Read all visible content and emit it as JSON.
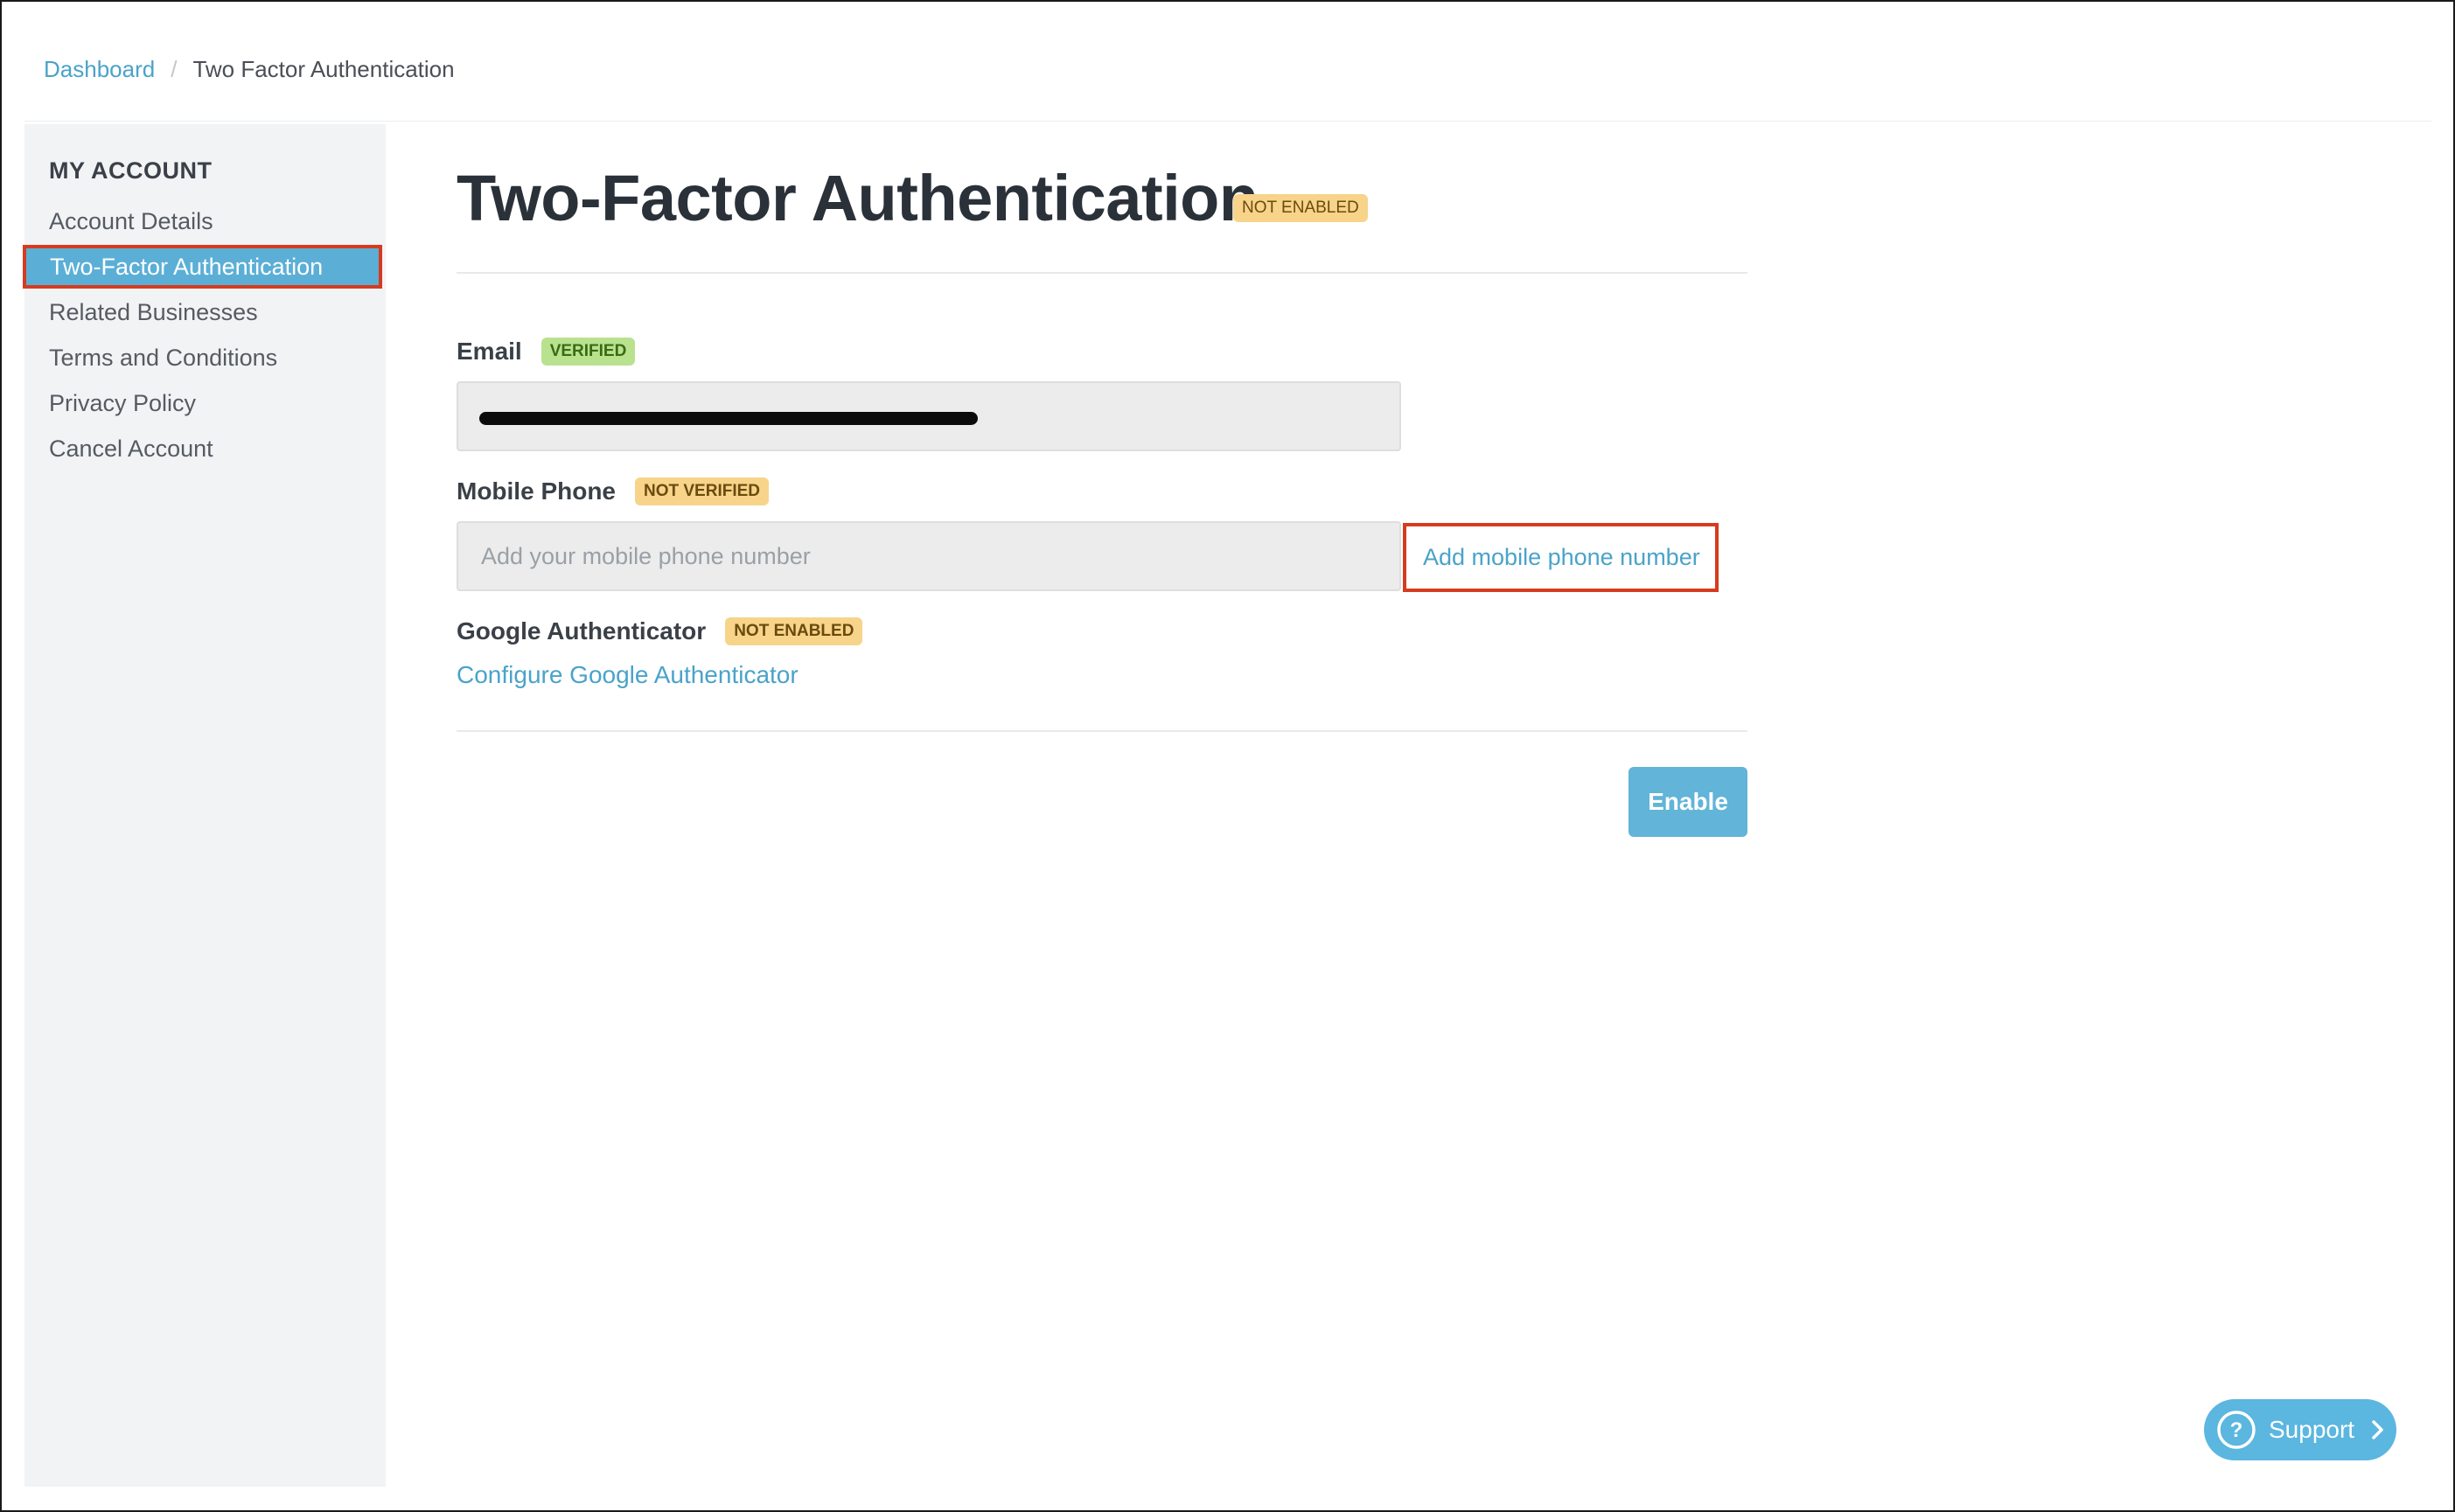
{
  "breadcrumb": {
    "home": "Dashboard",
    "separator": "/",
    "current": "Two Factor Authentication"
  },
  "sidebar": {
    "heading": "MY ACCOUNT",
    "items": [
      {
        "label": "Account Details"
      },
      {
        "label": "Two-Factor Authentication",
        "active": true
      },
      {
        "label": "Related Businesses"
      },
      {
        "label": "Terms and Conditions"
      },
      {
        "label": "Privacy Policy"
      },
      {
        "label": "Cancel Account"
      }
    ]
  },
  "main": {
    "title": "Two-Factor Authentication",
    "status_badge": "NOT ENABLED",
    "email": {
      "label": "Email",
      "badge": "VERIFIED",
      "value_redacted": true
    },
    "mobile": {
      "label": "Mobile Phone",
      "badge": "NOT VERIFIED",
      "placeholder": "Add your mobile phone number",
      "value": "",
      "add_link": "Add mobile phone number"
    },
    "google_auth": {
      "label": "Google Authenticator",
      "badge": "NOT ENABLED",
      "configure_link": "Configure Google Authenticator"
    },
    "enable_button": "Enable"
  },
  "support": {
    "label": "Support",
    "icon": "question-circle-icon"
  },
  "colors": {
    "accent": "#4aa3c9",
    "active_bg": "#5bafd6",
    "highlight_border": "#d63b1f",
    "warn_badge": "#f7d48a",
    "ok_badge": "#b9e28f",
    "button": "#62b4d8"
  }
}
